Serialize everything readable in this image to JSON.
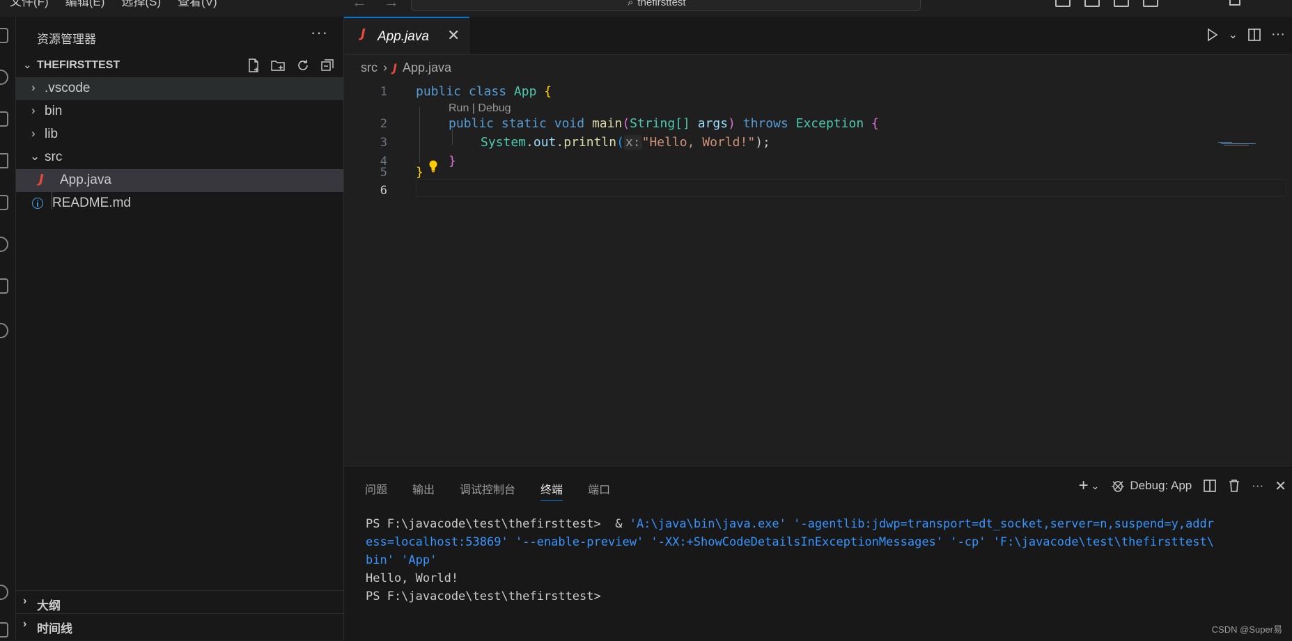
{
  "menu": [
    "文件(F)",
    "编辑(E)",
    "选择(S)",
    "查看(V)",
    "···"
  ],
  "command_center": {
    "label": "thefirsttest"
  },
  "sidebar": {
    "title": "资源管理器",
    "more": "···",
    "folder": "THEFIRSTTEST",
    "tree": [
      {
        "label": ".vscode",
        "type": "folder"
      },
      {
        "label": "bin",
        "type": "folder"
      },
      {
        "label": "lib",
        "type": "folder"
      },
      {
        "label": "src",
        "type": "folder-open"
      },
      {
        "label": "App.java",
        "type": "java",
        "icon": "J"
      },
      {
        "label": "README.md",
        "type": "info",
        "icon": "i"
      }
    ],
    "sections": [
      "大纲",
      "时间线"
    ]
  },
  "editor": {
    "tab": {
      "label": "App.java",
      "icon": "J"
    },
    "breadcrumb": [
      "src",
      "App.java"
    ],
    "line_numbers": [
      "1",
      "2",
      "3",
      "4",
      "5",
      "6"
    ],
    "codelens": "Run | Debug",
    "code": {
      "l1": [
        "public",
        "class",
        "App",
        "{"
      ],
      "l2": [
        "public",
        "static",
        "void",
        "main",
        "(",
        "String[]",
        "args",
        ")",
        "throws",
        "Exception",
        "{"
      ],
      "l3": [
        "System",
        ".",
        "out",
        ".",
        "println",
        "(",
        "x:",
        "\"Hello, World!\"",
        ");"
      ],
      "l4": [
        "}"
      ],
      "l5": [
        "}"
      ]
    }
  },
  "panel": {
    "tabs": [
      "问题",
      "输出",
      "调试控制台",
      "终端",
      "端口"
    ],
    "active_tab": "终端",
    "debug_label": "Debug: App",
    "terminal_lines": [
      {
        "prompt": "PS F:\\javacode\\test\\thefirsttest>",
        "cmd": "  & ",
        "args": "'A:\\java\\bin\\java.exe' '-agentlib:jdwp=transport=dt_socket,server=n,suspend=y,addr"
      },
      {
        "text": "ess=localhost:53869' '--enable-preview' '-XX:+ShowCodeDetailsInExceptionMessages' '-cp' 'F:\\javacode\\test\\thefirsttest\\"
      },
      {
        "text": "bin' 'App'"
      },
      {
        "plain": "Hello, World!"
      },
      {
        "plain": "PS F:\\javacode\\test\\thefirsttest>"
      }
    ]
  },
  "watermark": "CSDN @Super易"
}
